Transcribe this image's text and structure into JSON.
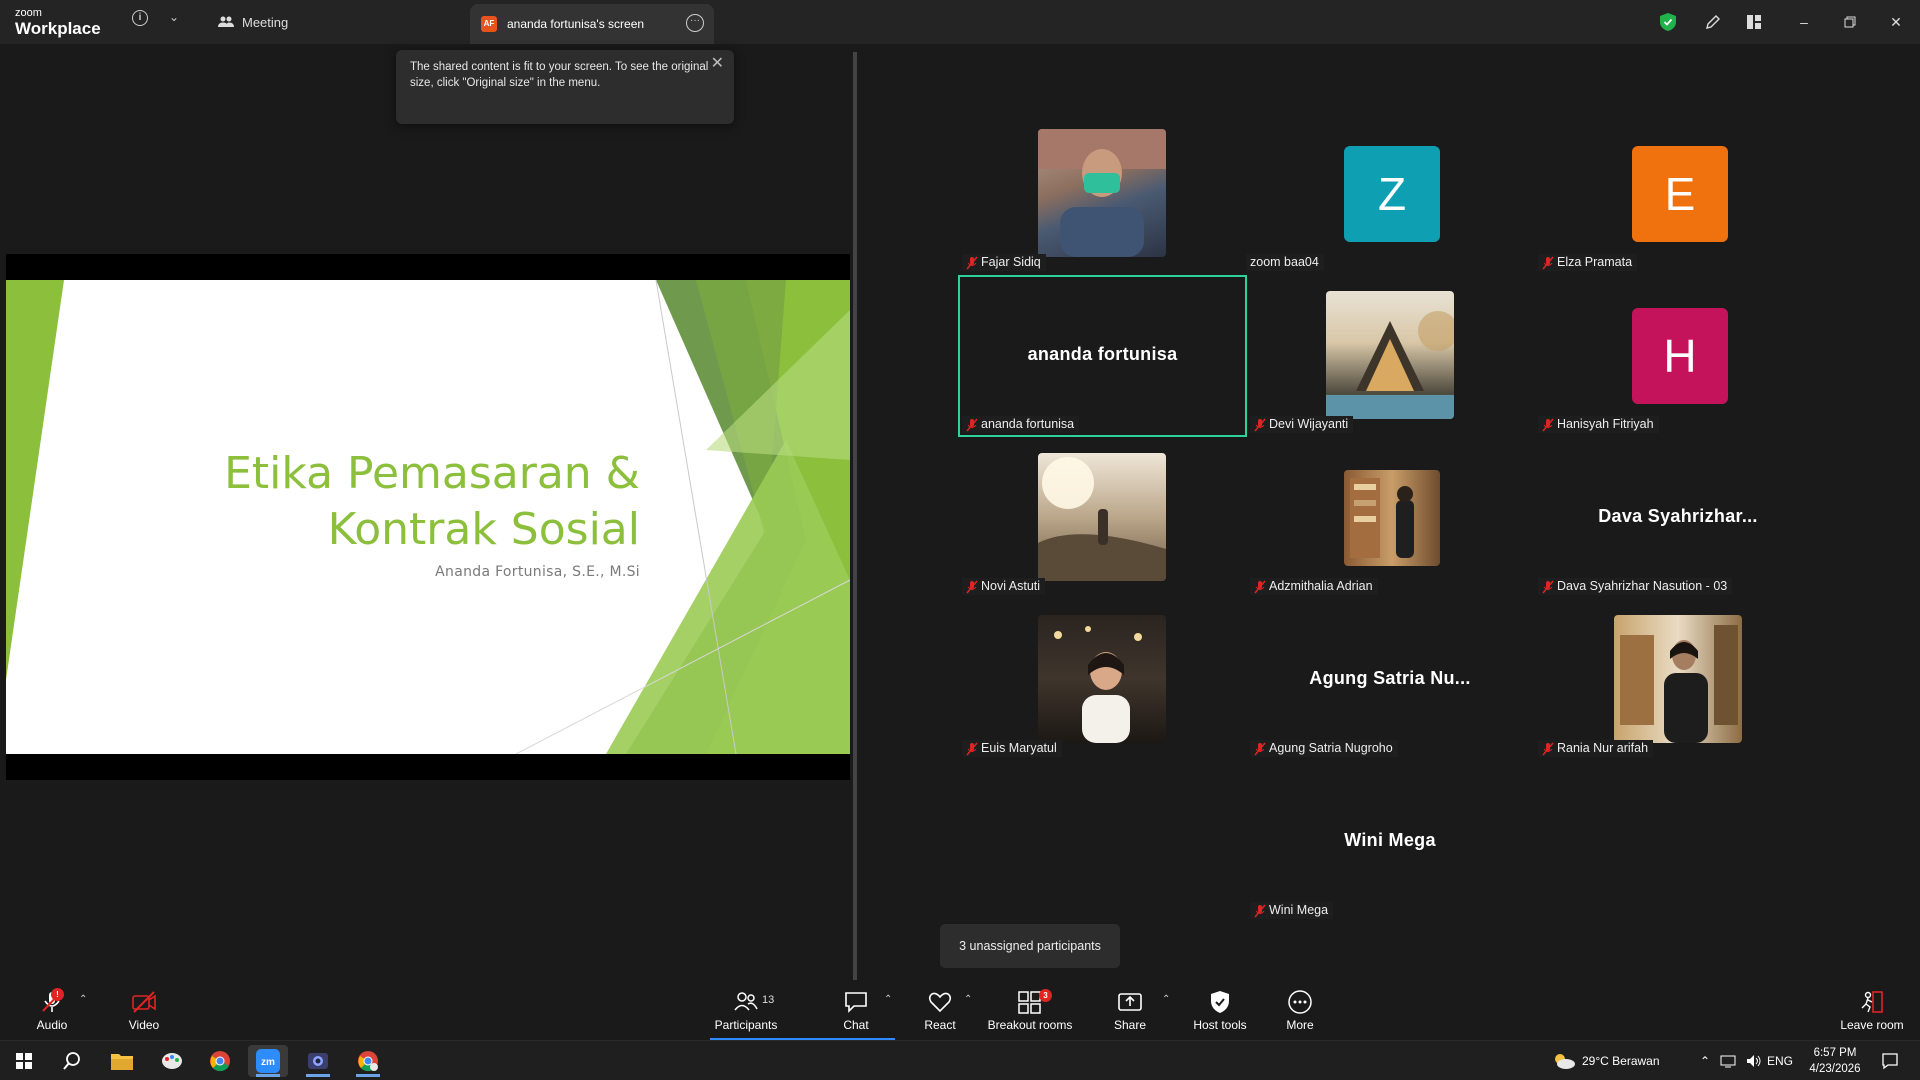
{
  "titlebar": {
    "logo_small": "zoom",
    "logo_big": "Workplace",
    "meeting_label": "Meeting",
    "tab_initials": "AF",
    "tab_label": "ananda fortunisa's screen"
  },
  "tooltip": {
    "text": "The shared content is fit to your screen. To see the original size, click \"Original size\" in the menu."
  },
  "slide": {
    "title_line1": "Etika Pemasaran &",
    "title_line2": "Kontrak Sosial",
    "subtitle": "Ananda Fortunisa, S.E., M.Si"
  },
  "participants": [
    {
      "name": "Fajar Sidiq",
      "type": "photo"
    },
    {
      "name": "zoom baa04",
      "type": "avatar",
      "letter": "Z",
      "color": "#0e9fb3"
    },
    {
      "name": "Elza Pramata",
      "type": "avatar",
      "letter": "E",
      "color": "#f0720f"
    },
    {
      "name": "ananda fortunisa",
      "display": "ananda fortunisa",
      "type": "name"
    },
    {
      "name": "Devi Wijayanti",
      "type": "photo"
    },
    {
      "name": "Hanisyah Fitriyah",
      "type": "avatar",
      "letter": "H",
      "color": "#c4135b"
    },
    {
      "name": "Novi Astuti",
      "type": "photo"
    },
    {
      "name": "Adzmithalia Adrian",
      "type": "photo"
    },
    {
      "name": "Dava Syahrizhar Nasution - 03",
      "display": "Dava  Syahrizhar...",
      "type": "name"
    },
    {
      "name": "Euis Maryatul",
      "type": "photo"
    },
    {
      "name": "Agung Satria Nugroho",
      "display": "Agung  Satria  Nu...",
      "type": "name"
    },
    {
      "name": "Rania Nur arifah",
      "type": "photo"
    },
    {
      "name": "Wini Mega",
      "display": "Wini Mega",
      "type": "name"
    }
  ],
  "unassigned": "3 unassigned participants",
  "toolbar": {
    "audio": "Audio",
    "video": "Video",
    "participants": "Participants",
    "participants_count": "13",
    "chat": "Chat",
    "react": "React",
    "breakout": "Breakout rooms",
    "breakout_badge": "3",
    "share": "Share",
    "host_tools": "Host tools",
    "more": "More",
    "leave": "Leave room"
  },
  "taskbar": {
    "weather": "29°C  Berawan",
    "lang": "ENG",
    "time": "6:57 PM",
    "date": "4/23/2026"
  },
  "colors": {
    "accent_green": "#2ed39a",
    "slide_green": "#8bbf3c",
    "mute_red": "#e02424"
  }
}
